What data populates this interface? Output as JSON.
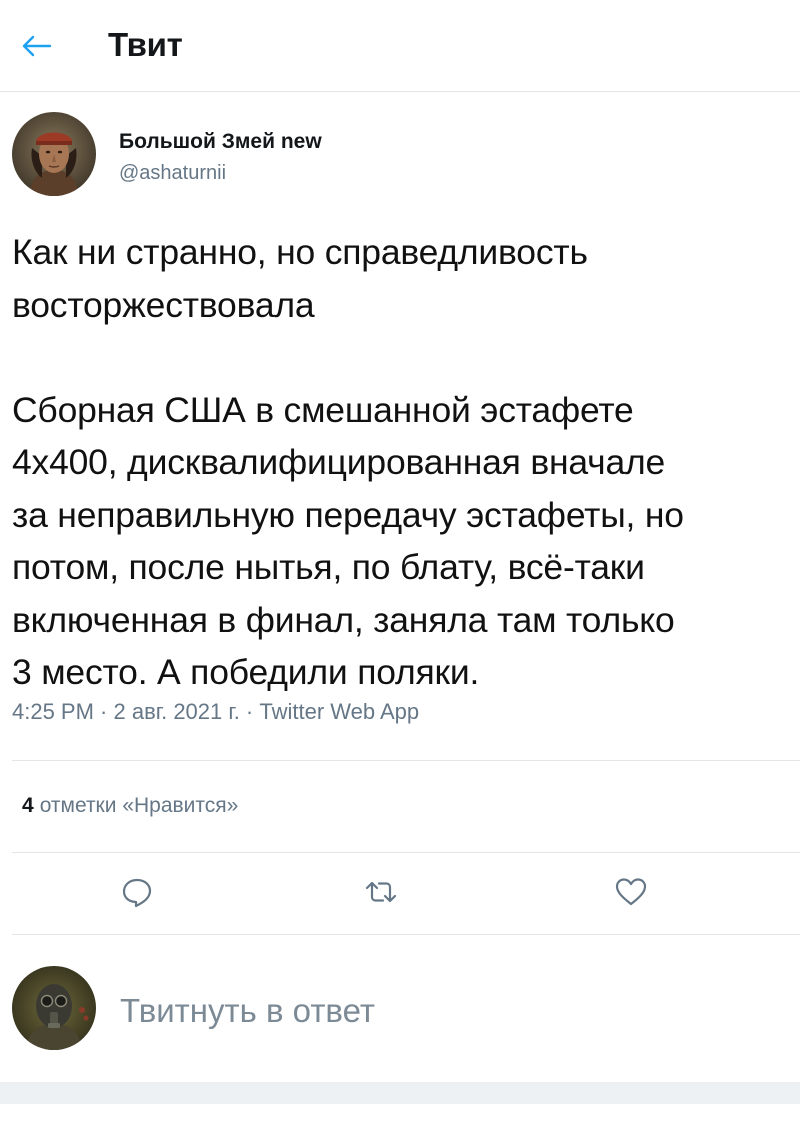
{
  "header": {
    "title": "Твит",
    "back_icon": "arrow-left-icon"
  },
  "author": {
    "display_name": "Большой Змей new",
    "handle": "@ashaturnii"
  },
  "tweet": {
    "paragraph1": [
      "Как ни странно, но справедливость",
      "восторжествовала"
    ],
    "paragraph2": [
      "Сборная США в смешанной эстафете",
      "4x400, дисквалифицированная вначале",
      "за неправильную передачу эстафеты, но",
      "потом, после нытья, по блату, всё-таки",
      "включенная в финал, заняла там только",
      "3 место. А победили поляки."
    ],
    "meta": "4:25 PM · 2 авг. 2021 г. · Twitter Web App"
  },
  "stats": {
    "likes_count": "4",
    "likes_label": "отметки «Нравится»"
  },
  "actions": {
    "reply_icon": "comment-icon",
    "retweet_icon": "retweet-icon",
    "like_icon": "heart-icon"
  },
  "reply": {
    "placeholder": "Твитнуть в ответ"
  },
  "colors": {
    "accent": "#1da1f2",
    "icon_gray": "#657786",
    "divider": "#e3e6e8"
  }
}
